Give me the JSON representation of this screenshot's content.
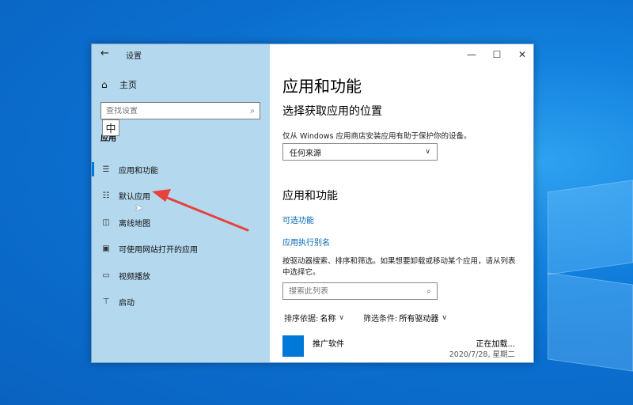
{
  "window": {
    "title": "设置",
    "back_icon": "←",
    "minimize_icon": "—",
    "maximize_icon": "☐",
    "close_icon": "✕"
  },
  "sidebar": {
    "home": {
      "icon": "home-icon",
      "label": "主页"
    },
    "search": {
      "placeholder": "查找设置",
      "icon": "search-icon"
    },
    "ime_char": "中",
    "section_label": "应用",
    "items": [
      {
        "icon": "apps-features-icon",
        "label": "应用和功能",
        "active": true
      },
      {
        "icon": "default-apps-icon",
        "label": "默认应用",
        "active": false
      },
      {
        "icon": "offline-maps-icon",
        "label": "离线地图",
        "active": false
      },
      {
        "icon": "apps-for-websites-icon",
        "label": "可使用网站打开的应用",
        "active": false
      },
      {
        "icon": "video-playback-icon",
        "label": "视频播放",
        "active": false
      },
      {
        "icon": "startup-icon",
        "label": "启动",
        "active": false
      }
    ]
  },
  "main": {
    "title": "应用和功能",
    "install_section": {
      "heading": "选择获取应用的位置",
      "description": "仅从 Windows 应用商店安装应用有助于保护你的设备。",
      "dropdown_value": "任何来源"
    },
    "apps_section": {
      "heading": "应用和功能",
      "link_optional": "可选功能",
      "link_aliases": "应用执行别名",
      "description": "按驱动器搜索、排序和筛选。如果想要卸载或移动某个应用，请从列表中选择它。",
      "search_placeholder": "搜索此列表",
      "sort_label": "排序依据:",
      "sort_value": "名称",
      "filter_label": "筛选条件:",
      "filter_value": "所有驱动器",
      "apps": [
        {
          "name": "推广软件",
          "status": "正在加载...",
          "date": "2020/7/28, 星期二"
        }
      ]
    }
  }
}
